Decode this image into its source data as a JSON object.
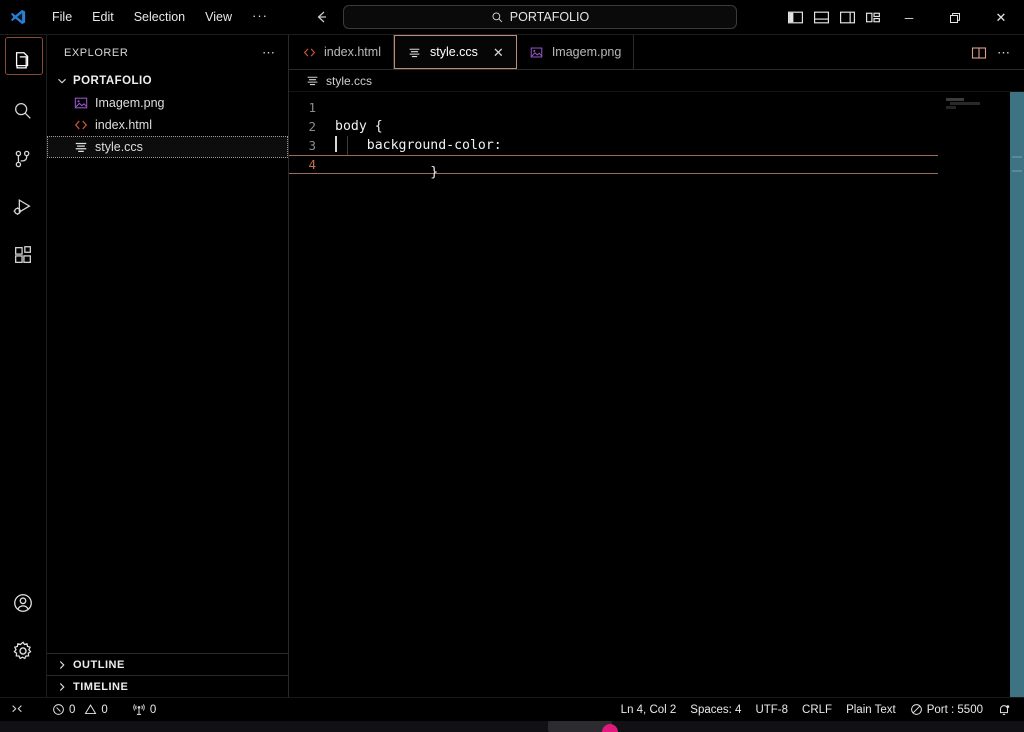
{
  "window": {
    "logo_icon": "vscode-logo-icon",
    "menu": [
      {
        "label": "File",
        "name": "menu-file"
      },
      {
        "label": "Edit",
        "name": "menu-edit"
      },
      {
        "label": "Selection",
        "name": "menu-selection"
      },
      {
        "label": "View",
        "name": "menu-view"
      },
      {
        "label": "···",
        "name": "menu-more"
      }
    ],
    "nav": {
      "back_icon": "arrow-left-icon",
      "forward_icon": "arrow-right-icon"
    },
    "command_center": {
      "text": "PORTAFOLIO",
      "icon": "search-icon",
      "placeholder": "Search"
    },
    "layout_icons": [
      {
        "name": "toggle-primary-sidebar-icon"
      },
      {
        "name": "toggle-panel-icon"
      },
      {
        "name": "toggle-secondary-sidebar-icon"
      },
      {
        "name": "customize-layout-icon"
      }
    ],
    "controls": {
      "minimize": "─",
      "maximize": "❐",
      "close": "✕"
    }
  },
  "activitybar": {
    "items": [
      {
        "name": "activity-explorer",
        "icon": "files-icon",
        "active": true
      },
      {
        "name": "activity-search",
        "icon": "search-icon",
        "active": false
      },
      {
        "name": "activity-source-control",
        "icon": "source-control-icon",
        "active": false
      },
      {
        "name": "activity-run-debug",
        "icon": "run-debug-icon",
        "active": false
      },
      {
        "name": "activity-extensions",
        "icon": "extensions-icon",
        "active": false
      }
    ],
    "bottom": [
      {
        "name": "activity-accounts",
        "icon": "account-icon"
      },
      {
        "name": "activity-settings",
        "icon": "gear-icon"
      }
    ]
  },
  "sidebar": {
    "title": "EXPLORER",
    "actions_icon": "ellipsis-icon",
    "folder": {
      "label": "PORTAFOLIO",
      "chevron": "chevron-down-icon",
      "expanded": true
    },
    "files": [
      {
        "label": "Imagem.png",
        "icon": "image-file-icon",
        "selected": false
      },
      {
        "label": "index.html",
        "icon": "html-file-icon",
        "selected": false
      },
      {
        "label": "style.ccs",
        "icon": "css-file-icon",
        "selected": true
      }
    ],
    "sections": [
      {
        "label": "OUTLINE",
        "chevron": "chevron-right-icon",
        "expanded": false
      },
      {
        "label": "TIMELINE",
        "chevron": "chevron-right-icon",
        "expanded": false
      }
    ]
  },
  "editor": {
    "tabs": [
      {
        "label": "index.html",
        "icon": "html-file-icon",
        "active": false,
        "closable": false
      },
      {
        "label": "style.ccs",
        "icon": "css-file-icon",
        "active": true,
        "closable": true,
        "close_icon": "close-icon"
      },
      {
        "label": "Imagem.png",
        "icon": "image-file-icon",
        "active": false,
        "closable": false
      }
    ],
    "actions": [
      {
        "name": "split-editor-right-button",
        "icon": "split-editor-icon"
      },
      {
        "name": "editor-more-actions-button",
        "icon": "ellipsis-icon"
      }
    ],
    "breadcrumb": {
      "label": "style.ccs",
      "icon": "css-file-icon"
    },
    "code": [
      {
        "number": "1",
        "text": "",
        "current": false,
        "indent_guide": false
      },
      {
        "number": "2",
        "text": "body {",
        "current": false,
        "indent_guide": false
      },
      {
        "number": "3",
        "text": "    background-color:",
        "current": false,
        "indent_guide": true
      },
      {
        "number": "4",
        "text": "}",
        "current": true,
        "indent_guide": false
      }
    ],
    "cursor": {
      "line": 4,
      "column": 2
    },
    "accent_color": "#c08b74",
    "scrollbar_color": "#3e7383"
  },
  "statusbar": {
    "left": [
      {
        "name": "remote-window-indicator",
        "label": "",
        "icon": "remote-icon"
      },
      {
        "name": "problems-errors",
        "label": "0",
        "icon": "error-icon"
      },
      {
        "name": "problems-warnings",
        "label": "0",
        "icon": "warning-icon"
      },
      {
        "name": "ports-forwarded",
        "label": "0",
        "icon": "radio-tower-icon"
      }
    ],
    "right": [
      {
        "name": "editor-selection-status",
        "label": "Ln 4, Col 2"
      },
      {
        "name": "editor-indentation",
        "label": "Spaces: 4"
      },
      {
        "name": "editor-encoding",
        "label": "UTF-8"
      },
      {
        "name": "editor-eol",
        "label": "CRLF"
      },
      {
        "name": "editor-language-mode",
        "label": "Plain Text"
      },
      {
        "name": "live-server-port",
        "label": "Port : 5500",
        "icon": "circle-slash-icon"
      },
      {
        "name": "notifications-bell",
        "label": "",
        "icon": "bell-dot-icon"
      }
    ]
  }
}
